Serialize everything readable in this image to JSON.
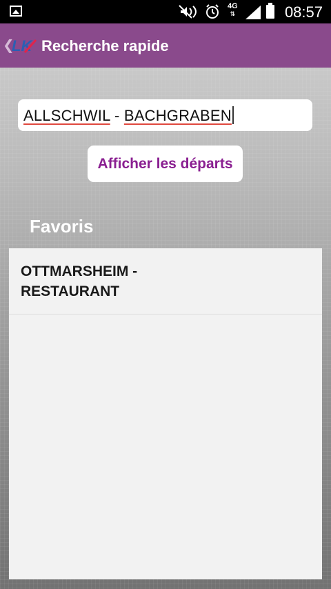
{
  "status_bar": {
    "time": "08:57",
    "network": "4G",
    "icons": [
      "gallery-icon",
      "mute-icon",
      "alarm-icon",
      "signal-icon",
      "battery-icon"
    ]
  },
  "app_bar": {
    "title": "Recherche rapide",
    "logo_text": "LK",
    "color": "#8a4a8c"
  },
  "search": {
    "value_word1": "ALLSCHWIL",
    "value_sep": " - ",
    "value_word2": "BACHGRABEN"
  },
  "actions": {
    "show_departures_label": "Afficher les départs",
    "accent": "#8a1f91"
  },
  "favorites": {
    "heading": "Favoris",
    "items": [
      {
        "line1": "OTTMARSHEIM -",
        "line2": "RESTAURANT"
      }
    ]
  }
}
